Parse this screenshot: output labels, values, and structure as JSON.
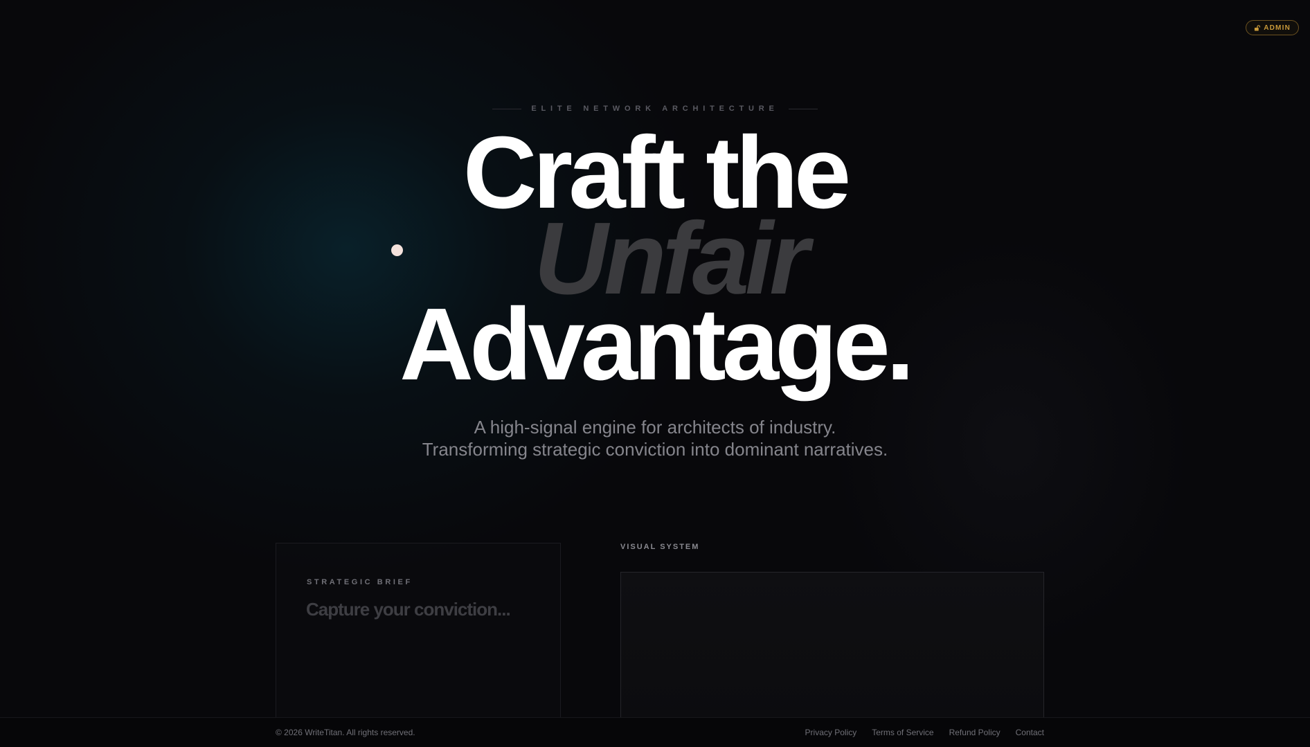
{
  "header": {
    "admin_label": "ADMIN",
    "admin_icon": "lock-icon"
  },
  "hero": {
    "eyebrow": "ELITE NETWORK ARCHITECTURE",
    "headline_line1": "Craft the",
    "headline_line2": "Unfair",
    "headline_line3": "Advantage.",
    "subtitle_line1": "A high-signal engine for architects of industry.",
    "subtitle_line2": "Transforming strategic conviction into dominant narratives."
  },
  "brief": {
    "label": "STRATEGIC BRIEF",
    "placeholder": "Capture your conviction..."
  },
  "visual": {
    "label": "VISUAL SYSTEM"
  },
  "footer": {
    "copyright": "© 2026 WriteTitan. All rights reserved.",
    "links": [
      "Privacy Policy",
      "Terms of Service",
      "Refund Policy",
      "Contact"
    ]
  },
  "colors": {
    "background": "#08080b",
    "accent_gold": "#c99a3a",
    "headline_white": "#ffffff",
    "headline_muted": "#3b3b3e",
    "dot": "#f4e2dc"
  }
}
